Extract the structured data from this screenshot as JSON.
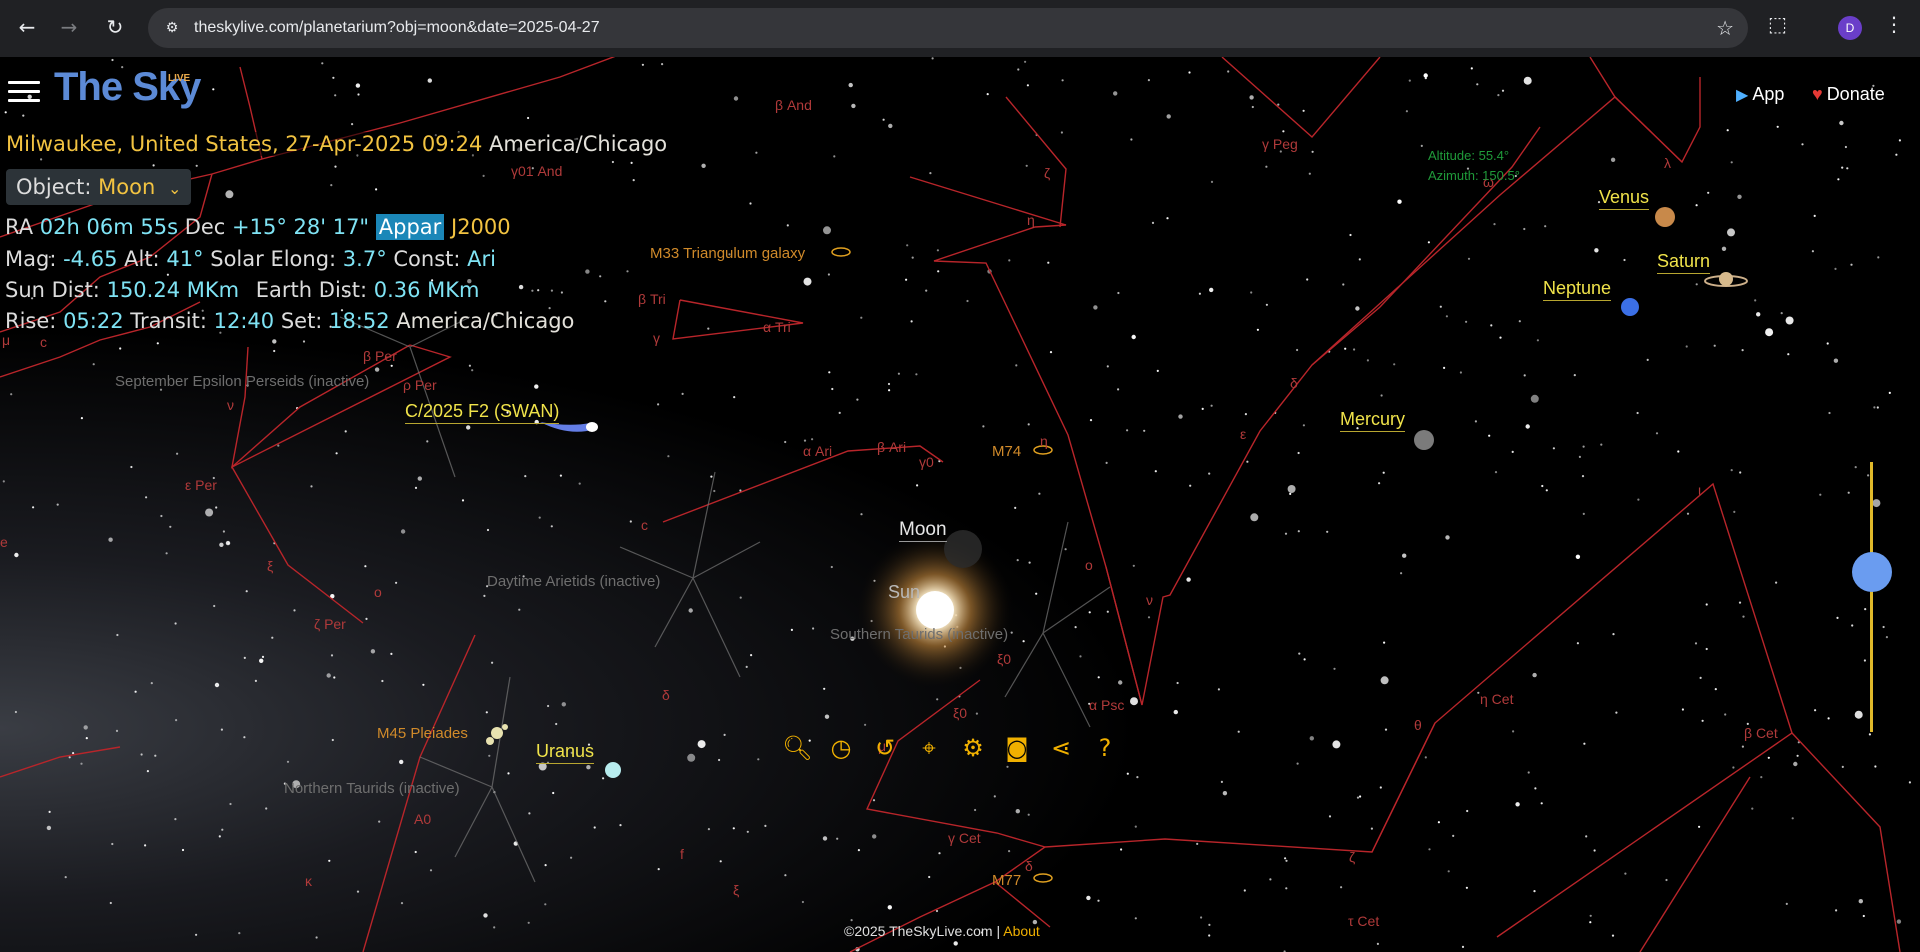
{
  "browser": {
    "url": "theskylive.com/planetarium?obj=moon&date=2025-04-27",
    "avatar_letter": "D"
  },
  "header": {
    "logo_text": "The Sky",
    "logo_live": "LIVE",
    "app_label": "App",
    "donate_label": "Donate"
  },
  "info": {
    "location_line": "Milwaukee, United States, 27-Apr-2025 09:24",
    "timezone": "America/Chicago",
    "object_label": "Object:",
    "object_value": "Moon",
    "ra_label": "RA",
    "ra_value": "02h 06m 55s",
    "dec_label": "Dec",
    "dec_value": "+15° 28' 17\"",
    "appar": "Appar",
    "j2000": "J2000",
    "mag_label": "Mag:",
    "mag_value": "-4.65",
    "alt_label": "Alt:",
    "alt_value": "41°",
    "elong_label": "Solar Elong:",
    "elong_value": "3.7°",
    "const_label": "Const:",
    "const_value": "Ari",
    "sundist_label": "Sun Dist:",
    "sundist_value": "150.24 MKm",
    "earthdist_label": "Earth Dist:",
    "earthdist_value": "0.36 MKm",
    "rise_label": "Rise:",
    "rise_value": "05:22",
    "transit_label": "Transit:",
    "transit_value": "12:40",
    "set_label": "Set:",
    "set_value": "18:52",
    "rise_tz": "America/Chicago"
  },
  "cursor_readout": {
    "altitude": "Altitude: 55.4°",
    "azimuth": "Azimuth: 150.5°"
  },
  "planets": {
    "venus": "Venus",
    "saturn": "Saturn",
    "neptune": "Neptune",
    "mercury": "Mercury",
    "uranus": "Uranus",
    "moon": "Moon",
    "sun": "Sun",
    "comet": "C/2025 F2 (SWAN)"
  },
  "deep_sky": {
    "m33": "M33 Triangulum galaxy",
    "m74": "M74",
    "m45": "M45 Pleiades",
    "m77": "M77"
  },
  "showers": {
    "sep_eps_per": "September Epsilon Perseids (inactive)",
    "daytime_arietids": "Daytime Arietids (inactive)",
    "southern_taurids": "Southern Taurids (inactive)",
    "northern_taurids": "Northern Taurids (inactive)"
  },
  "star_labels": {
    "gamma_peg": "γ Peg",
    "beta_and": "β And",
    "gamma01_and": "γ01 And",
    "beta_tri": "β Tri",
    "alpha_tri": "α Tri",
    "gamma_tri": "γ",
    "beta_per": "β Per",
    "rho_per": "ρ Per",
    "eps_per": "ε Per",
    "xi_per": "ξ",
    "omicron_per": "ο",
    "zeta_per": "ζ Per",
    "alpha_ari": "α Ari",
    "beta_ari": "β Ari",
    "gamma0_ari": "γ0",
    "c_ari": "c",
    "delta_ari": "δ",
    "alpha_psc": "α Psc",
    "xi0_psc": "ξ0",
    "omicron_psc": "ο",
    "nu_psc": "ν",
    "eta_and": "η",
    "zeta_and": "ζ",
    "delta_psc": "δ",
    "eps_psc": "ε",
    "eta_cet": "η Cet",
    "theta_cet": "θ",
    "beta_cet": "β Cet",
    "gamma_cet": "γ Cet",
    "delta_cet": "δ",
    "zeta_cet": "ζ",
    "tau_cet": "τ Cet",
    "xi0_cet": "ξ0",
    "mu_cet": "μ",
    "f_tau": "f",
    "a0": "A0",
    "lambda_peg": "λ",
    "omega_psc": "ω",
    "iota_cet": "ι",
    "nu_per": "ν",
    "eta_psc": "η",
    "xi_cet": "ξ",
    "c_per": "c",
    "mu_per": "μ",
    "e_lbl": "e",
    "kappa": "κ"
  },
  "footer": {
    "copyright": "©2025 TheSkyLive.com |",
    "about": "About"
  },
  "colors": {
    "background": "#000000",
    "constellation_line": "#b8252a",
    "accent_yellow": "#f2c341",
    "accent_cyan": "#7fe3f4",
    "planet_label": "#f0e34a",
    "toolbar": "#f0b000"
  },
  "icons": [
    "back-icon",
    "forward-icon",
    "reload-icon",
    "site-info-icon",
    "bookmark-star-icon",
    "extensions-icon",
    "menu-kebab-icon",
    "hamburger-icon",
    "play-store-icon",
    "heart-icon",
    "chevron-down-icon",
    "search-icon",
    "clock-icon",
    "time-travel-icon",
    "location-icon",
    "settings-gear-icon",
    "camera-icon",
    "share-icon",
    "help-icon"
  ]
}
